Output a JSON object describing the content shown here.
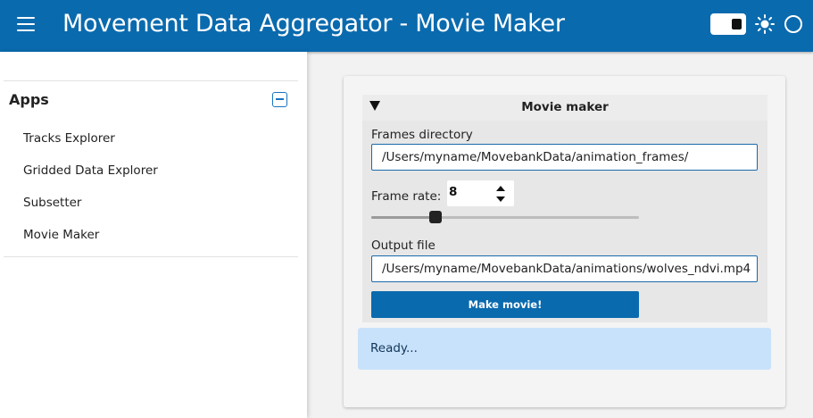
{
  "header": {
    "title": "Movement Data Aggregator  -  Movie Maker",
    "menu_icon": "hamburger-menu-icon",
    "theme_toggle_icon": "toggle-switch-icon",
    "light_icon": "sun-icon",
    "dark_icon": "circle-icon",
    "background_color": "#0a6aae"
  },
  "sidebar": {
    "title": "Apps",
    "collapse_icon": "minus-square-icon",
    "items": [
      {
        "label": "Tracks Explorer"
      },
      {
        "label": "Gridded Data Explorer"
      },
      {
        "label": "Subsetter"
      },
      {
        "label": "Movie Maker"
      }
    ]
  },
  "panel": {
    "title": "Movie maker",
    "collapse_icon": "triangle-down-icon",
    "frames_directory": {
      "label": "Frames directory",
      "value": "/Users/myname/MovebankData/animation_frames/"
    },
    "frame_rate": {
      "label": "Frame rate:",
      "value": "8",
      "slider_fraction": 0.24
    },
    "output_file": {
      "label": "Output file",
      "value": "/Users/myname/MovebankData/animations/wolves_ndvi.mp4"
    },
    "button_label": "Make movie!",
    "button_color": "#0a6aae"
  },
  "status": {
    "text": "Ready...",
    "background_color": "#c9e2fb"
  }
}
